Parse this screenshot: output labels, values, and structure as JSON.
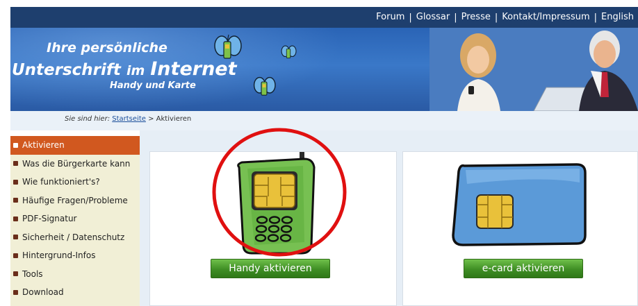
{
  "topnav": {
    "links": [
      "Forum",
      "Glossar",
      "Presse",
      "Kontakt/Impressum",
      "English"
    ]
  },
  "banner": {
    "line1": "Ihre persönliche",
    "line2_a": "Unterschrift",
    "line2_b": "im",
    "line2_c": "Internet",
    "line3": "Handy und Karte"
  },
  "breadcrumb": {
    "prefix": "Sie sind hier:",
    "home": "Startseite",
    "separator": ">",
    "current": "Aktivieren"
  },
  "sidebar": {
    "items": [
      {
        "label": "Aktivieren",
        "active": true
      },
      {
        "label": "Was die Bürgerkarte kann"
      },
      {
        "label": "Wie funktioniert's?"
      },
      {
        "label": "Häufige Fragen/Probleme"
      },
      {
        "label": "PDF-Signatur"
      },
      {
        "label": "Sicherheit / Datenschutz"
      },
      {
        "label": "Hintergrund-Infos"
      },
      {
        "label": "Tools"
      },
      {
        "label": "Download"
      }
    ]
  },
  "main": {
    "phone_button": "Handy aktivieren",
    "card_button": "e-card aktivieren"
  },
  "colors": {
    "nav_bg": "#1e3f6e",
    "menu_active": "#d1581f",
    "button_green": "#3f8e24",
    "highlight_circle": "#e01010"
  }
}
